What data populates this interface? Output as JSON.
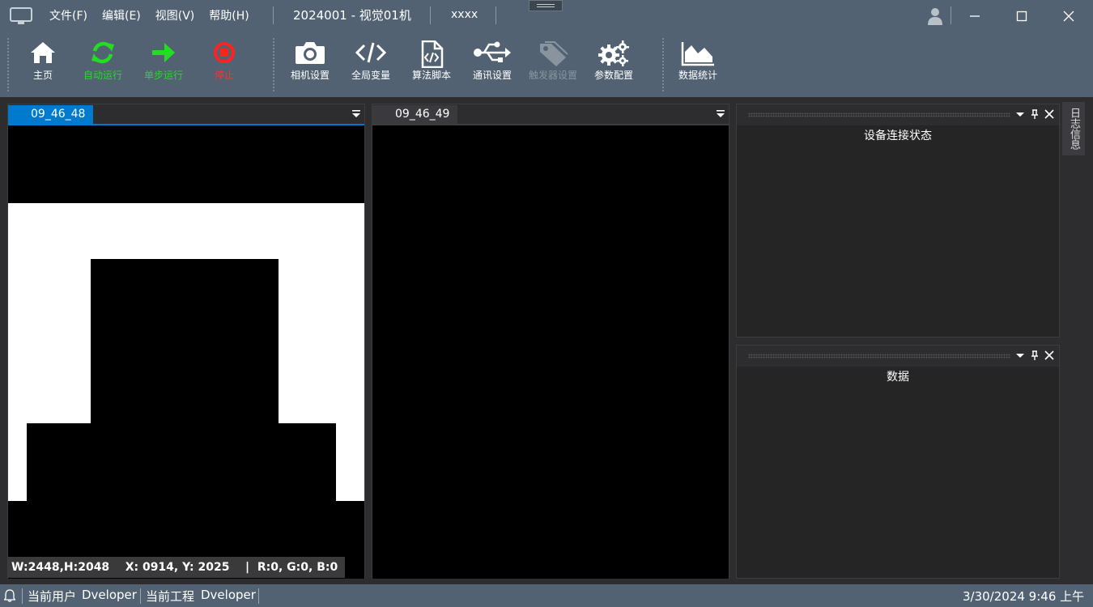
{
  "titlebar": {
    "menu": [
      "文件(F)",
      "编辑(E)",
      "视图(V)",
      "帮助(H)"
    ],
    "project": "2024001 - 视觉01机",
    "extra": "xxxx",
    "icons": [
      "monitor-icon",
      "user-icon",
      "minimize-icon",
      "maximize-icon",
      "close-icon"
    ]
  },
  "toolbar": {
    "tools": [
      {
        "label": "主页",
        "icon": "home-icon",
        "color": "#ffffff"
      },
      {
        "label": "自动运行",
        "icon": "refresh-icon",
        "color": "#22dd22"
      },
      {
        "label": "单步运行",
        "icon": "arrow-right-icon",
        "color": "#22dd22"
      },
      {
        "label": "停止",
        "icon": "stop-icon",
        "color": "#ff2222"
      },
      {
        "label": "相机设置",
        "icon": "camera-icon",
        "color": "#ffffff"
      },
      {
        "label": "全局变量",
        "icon": "code-icon",
        "color": "#ffffff"
      },
      {
        "label": "算法脚本",
        "icon": "script-file-icon",
        "color": "#ffffff"
      },
      {
        "label": "通讯设置",
        "icon": "usb-icon",
        "color": "#ffffff"
      },
      {
        "label": "触发器设置",
        "icon": "tag-icon",
        "color": "#8a949e"
      },
      {
        "label": "参数配置",
        "icon": "gears-icon",
        "color": "#ffffff"
      },
      {
        "label": "数据统计",
        "icon": "area-chart-icon",
        "color": "#ffffff"
      }
    ]
  },
  "docs": [
    {
      "tab": "09_46_48",
      "active": true
    },
    {
      "tab": "09_46_49",
      "active": false
    }
  ],
  "imageinfo": {
    "size": "W:2448,H:2048",
    "pos": "X: 0914, Y: 2025",
    "divider": "|",
    "rgb": "R:0, G:0, B:0"
  },
  "panes": [
    {
      "title": "设备连接状态"
    },
    {
      "title": "数据"
    }
  ],
  "sidetab": "日志信息",
  "status": {
    "user_label": "当前用户",
    "user": "Dveloper",
    "project_label": "当前工程",
    "project": "Dveloper",
    "datetime": "3/30/2024 9:46 上午"
  },
  "colors": {
    "accent": "#007acc",
    "chrome": "#526273",
    "panel": "#252526"
  }
}
